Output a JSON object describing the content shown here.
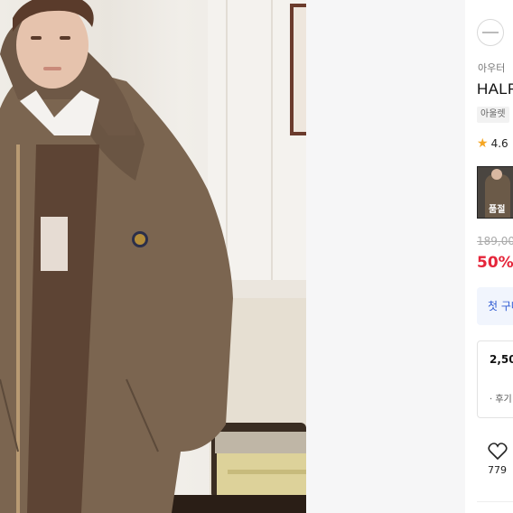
{
  "product": {
    "category": "아우터",
    "title": "HALF",
    "badge": "아울렛",
    "rating": "4.6",
    "thumbnail_label": "품절",
    "original_price": "189,00",
    "discount": "50%",
    "coupon_text": "첫 구매",
    "point_amount": "2,50",
    "point_note": "· 후기",
    "likes": "779"
  },
  "icons": {
    "rating_icon": "star-icon",
    "like_icon": "heart-icon"
  },
  "colors": {
    "discount": "#e5253a",
    "coupon_text": "#2f5bd3",
    "coupon_bg": "#f1f5fd",
    "star": "#f5a623"
  }
}
